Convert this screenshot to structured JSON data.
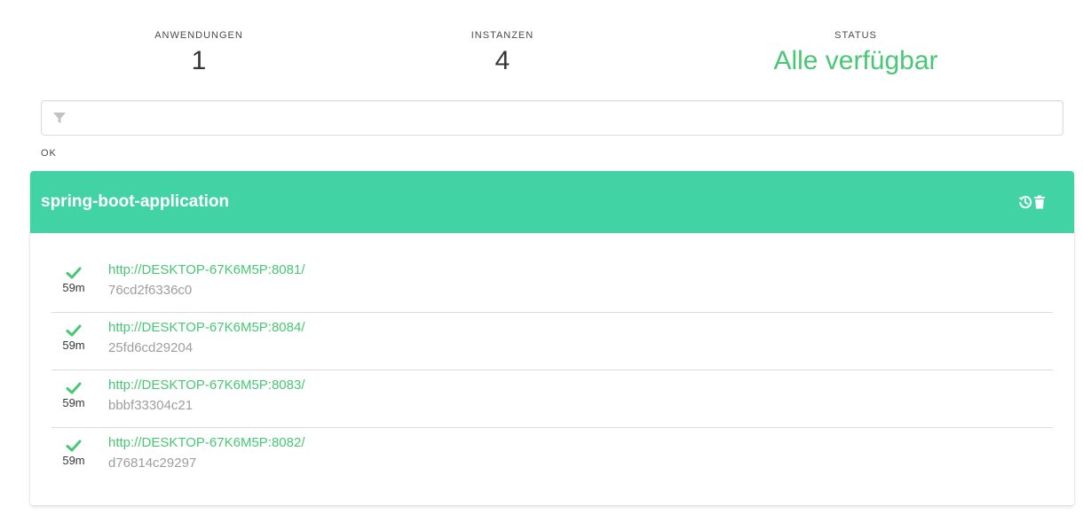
{
  "stats": {
    "applications_label": "ANWENDUNGEN",
    "applications_value": "1",
    "instances_label": "INSTANZEN",
    "instances_value": "4",
    "status_label": "STATUS",
    "status_value": "Alle verfügbar"
  },
  "filter": {
    "placeholder": "",
    "value": ""
  },
  "group": {
    "label": "OK"
  },
  "application": {
    "name": "spring-boot-application",
    "instances": [
      {
        "url": "http://DESKTOP-67K6M5P:8081/",
        "id": "76cd2f6336c0",
        "uptime": "59m"
      },
      {
        "url": "http://DESKTOP-67K6M5P:8084/",
        "id": "25fd6cd29204",
        "uptime": "59m"
      },
      {
        "url": "http://DESKTOP-67K6M5P:8083/",
        "id": "bbbf33304c21",
        "uptime": "59m"
      },
      {
        "url": "http://DESKTOP-67K6M5P:8082/",
        "id": "d76814c29297",
        "uptime": "59m"
      }
    ]
  },
  "colors": {
    "accent": "#42d3a5",
    "status_up": "#48c774",
    "muted": "#9e9e9e"
  }
}
